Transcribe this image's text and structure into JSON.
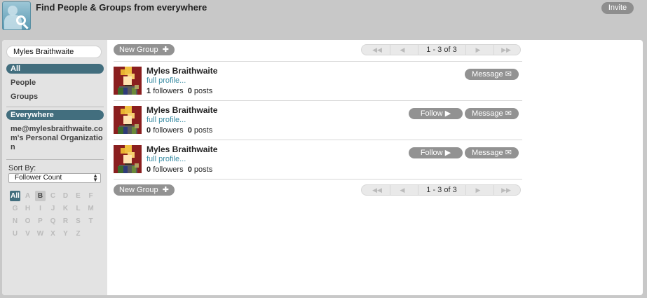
{
  "header": {
    "title": "Find People & Groups from everywhere",
    "invite_label": "Invite"
  },
  "sidebar": {
    "search_value": "Myles Braithwaite",
    "filters": {
      "all": "All",
      "people": "People",
      "groups": "Groups"
    },
    "scope": {
      "everywhere": "Everywhere",
      "org": "me@mylesbraithwaite.com's Personal Organization"
    },
    "sort_by_label": "Sort By:",
    "sort_value": "Follower Count",
    "letters": [
      "All",
      "A",
      "B",
      "C",
      "D",
      "E",
      "F",
      "G",
      "H",
      "I",
      "J",
      "K",
      "L",
      "M",
      "N",
      "O",
      "P",
      "Q",
      "R",
      "S",
      "T",
      "U",
      "V",
      "W",
      "X",
      "Y",
      "Z"
    ]
  },
  "toolbar": {
    "new_group_label": "New Group",
    "page_text": "1 - 3 of 3"
  },
  "people": [
    {
      "name": "Myles Braithwaite",
      "profile_link": "full profile...",
      "followers": "1",
      "followers_label": "followers",
      "posts": "0",
      "posts_label": "posts",
      "follow_label": "",
      "message_label": "Message"
    },
    {
      "name": "Myles Braithwaite",
      "profile_link": "full profile...",
      "followers": "0",
      "followers_label": "followers",
      "posts": "0",
      "posts_label": "posts",
      "follow_label": "Follow",
      "message_label": "Message"
    },
    {
      "name": "Myles Braithwaite",
      "profile_link": "full profile...",
      "followers": "0",
      "followers_label": "followers",
      "posts": "0",
      "posts_label": "posts",
      "follow_label": "Follow",
      "message_label": "Message"
    }
  ],
  "colors": {
    "accent": "#426e7e",
    "link": "#3a8ca3",
    "button": "#929292"
  }
}
